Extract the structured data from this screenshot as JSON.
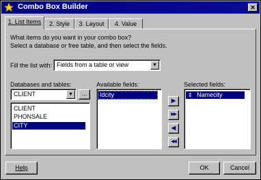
{
  "window": {
    "title": "Combo Box Builder"
  },
  "tabs": [
    {
      "label": "1. List Items"
    },
    {
      "label": "2. Style"
    },
    {
      "label": "3. Layout"
    },
    {
      "label": "4. Value"
    }
  ],
  "instructions": {
    "line1": "What items do you want in your combo box?",
    "line2": "Select a database or free table, and then select the fields."
  },
  "fill_list": {
    "label": "Fill the list with:",
    "value": "Fields from a table or view"
  },
  "databases": {
    "label": "Databases and tables:",
    "combo_value": "CLIENT",
    "browse_label": "...",
    "items": [
      "CLIENT",
      "PHONSALE",
      "CITY"
    ]
  },
  "available_fields": {
    "label": "Available fields:",
    "items": [
      "Idcity"
    ]
  },
  "selected_fields": {
    "label": "Selected fields:",
    "items": [
      "Namecity"
    ]
  },
  "move_buttons": [
    {
      "glyph": "▶"
    },
    {
      "glyph": "▶▶"
    },
    {
      "glyph": "◀"
    },
    {
      "glyph": "◀◀"
    }
  ],
  "footer": {
    "help": "Help",
    "ok": "OK",
    "cancel": "Cancel"
  }
}
